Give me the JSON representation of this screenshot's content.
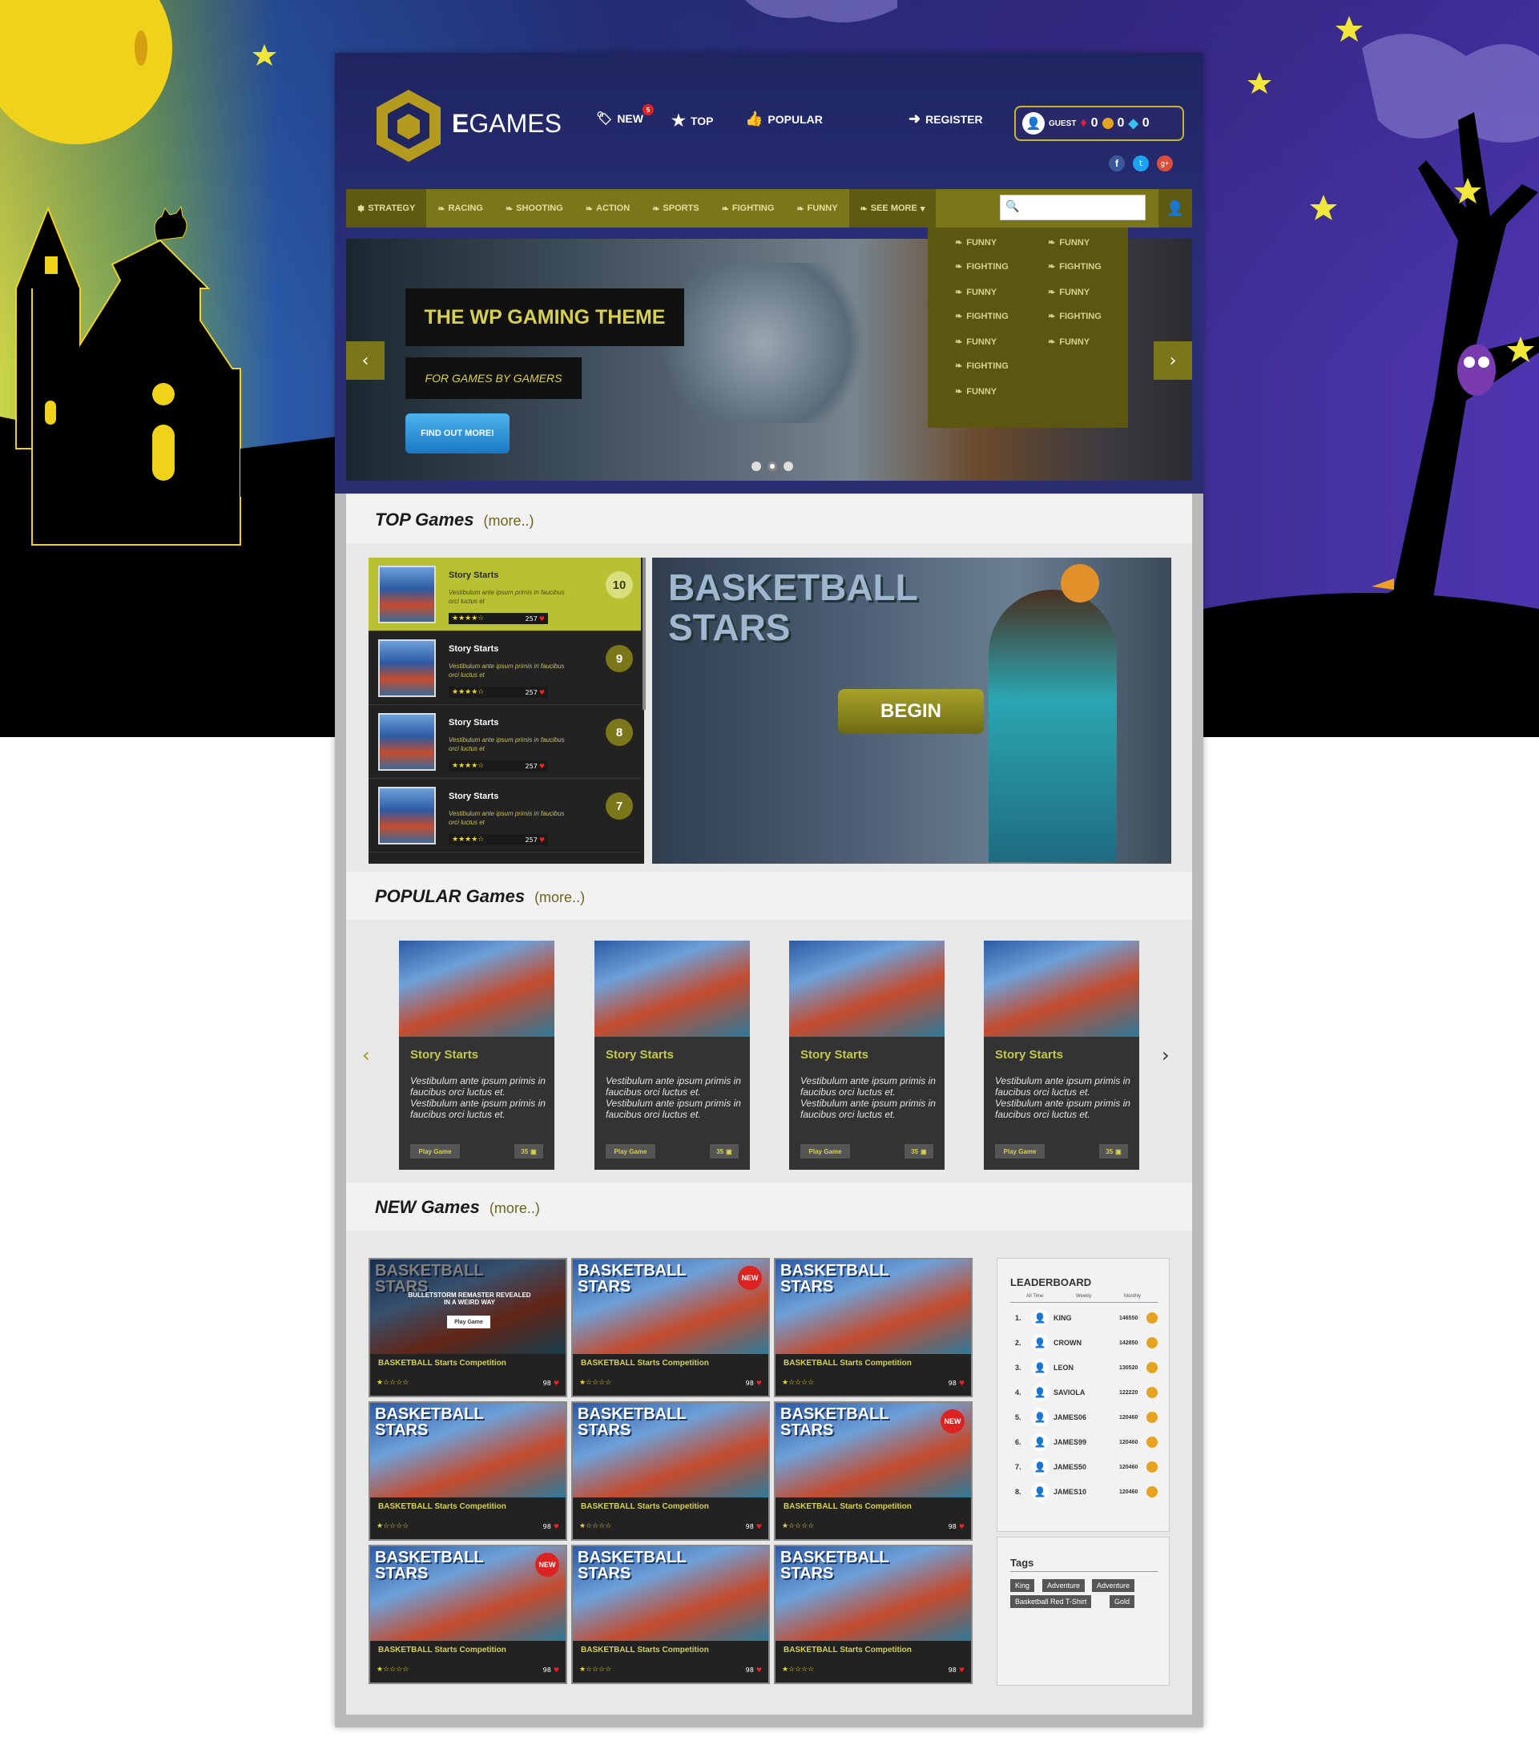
{
  "brand": {
    "logo_letter": "G",
    "name_bold": "E",
    "name_rest": "GAMES"
  },
  "top_nav": [
    {
      "label": "NEW",
      "icon": "tag-icon",
      "badge": "5"
    },
    {
      "label": "TOP",
      "icon": "star-icon"
    },
    {
      "label": "POPULAR",
      "icon": "thumbs-up-icon"
    },
    {
      "label": "REGISTER",
      "icon": "arrow-icon"
    }
  ],
  "user": {
    "name": "GUEST",
    "gems_red": "0",
    "coins": "0",
    "diamonds": "0"
  },
  "categories": [
    "STRATEGY",
    "RACING",
    "SHOOTING",
    "ACTION",
    "SPORTS",
    "FIGHTING",
    "FUNNY",
    "SEE MORE"
  ],
  "dropdown": {
    "left": [
      "FUNNY",
      "FIGHTING",
      "FUNNY",
      "FIGHTING",
      "FUNNY",
      "FIGHTING",
      "FUNNY"
    ],
    "right": [
      "FUNNY",
      "FIGHTING",
      "FUNNY",
      "FIGHTING",
      "FUNNY"
    ]
  },
  "hero": {
    "title": "THE WP GAMING THEME",
    "subtitle": "FOR GAMES BY GAMERS",
    "cta": "FIND OUT MORE!"
  },
  "top_games": {
    "title": "TOP Games",
    "more": "(more..)",
    "items": [
      {
        "title": "Story Starts",
        "desc": "Vestibulum ante ipsum primis in faucibus orci luctus et",
        "count": "257",
        "rank": "10",
        "rating": 4.5
      },
      {
        "title": "Story Starts",
        "desc": "Vestibulum ante ipsum primis in faucibus orci luctus et",
        "count": "257",
        "rank": "9",
        "rating": 4.5
      },
      {
        "title": "Story Starts",
        "desc": "Vestibulum ante ipsum primis in faucibus orci luctus et",
        "count": "257",
        "rank": "8",
        "rating": 4.5
      },
      {
        "title": "Story Starts",
        "desc": "Vestibulum ante ipsum primis in faucibus orci luctus et",
        "count": "257",
        "rank": "7",
        "rating": 4.5
      }
    ],
    "feature_button": "BEGIN",
    "feature_title": "BASKETBALL STARS"
  },
  "popular_games": {
    "title": "POPULAR Games",
    "more": "(more..)",
    "cards": [
      {
        "title": "Story Starts",
        "desc": "Vestibulum ante ipsum primis in faucibus orci luctus et. Vestibulum ante ipsum primis in faucibus orci luctus et.",
        "play": "Play Game",
        "count": "35"
      },
      {
        "title": "Story Starts",
        "desc": "Vestibulum ante ipsum primis in faucibus orci luctus et. Vestibulum ante ipsum primis in faucibus orci luctus et.",
        "play": "Play Game",
        "count": "35"
      },
      {
        "title": "Story Starts",
        "desc": "Vestibulum ante ipsum primis in faucibus orci luctus et. Vestibulum ante ipsum primis in faucibus orci luctus et.",
        "play": "Play Game",
        "count": "35"
      },
      {
        "title": "Story Starts",
        "desc": "Vestibulum ante ipsum primis in faucibus orci luctus et. Vestibulum ante ipsum primis in faucibus orci luctus et.",
        "play": "Play Game",
        "count": "35"
      }
    ]
  },
  "new_games": {
    "title": "NEW Games",
    "more": "(more..)",
    "overlay_title": "BULLETSTORM REMASTER REVEALED IN A WEIRD WAY",
    "overlay_button": "Play Game",
    "new_badge": "NEW",
    "card_title": "BASKETBALL Starts Competition",
    "card_count": "98",
    "card_rating": 1.5,
    "card_art": "BASKETBALL STARS"
  },
  "leaderboard": {
    "title": "LEADERBOARD",
    "tabs": [
      "All Time",
      "Weekly",
      "Monthly"
    ],
    "rows": [
      {
        "rank": "1.",
        "name": "KING",
        "score": "146550"
      },
      {
        "rank": "2.",
        "name": "CROWN",
        "score": "142850"
      },
      {
        "rank": "3.",
        "name": "LEON",
        "score": "130520"
      },
      {
        "rank": "4.",
        "name": "SAVIOLA",
        "score": "122220"
      },
      {
        "rank": "5.",
        "name": "JAMES06",
        "score": "120460"
      },
      {
        "rank": "6.",
        "name": "JAMES99",
        "score": "120460"
      },
      {
        "rank": "7.",
        "name": "JAMES50",
        "score": "120460"
      },
      {
        "rank": "8.",
        "name": "JAMES10",
        "score": "120460"
      }
    ]
  },
  "tags": {
    "title": "Tags",
    "items": [
      "King",
      "Adventure",
      "Adventure",
      "Basketball Red T-Shirt",
      "Gold"
    ]
  },
  "colors": {
    "accent": "#7b761a",
    "accent_light": "#b7c131",
    "header": "#1e2560"
  }
}
